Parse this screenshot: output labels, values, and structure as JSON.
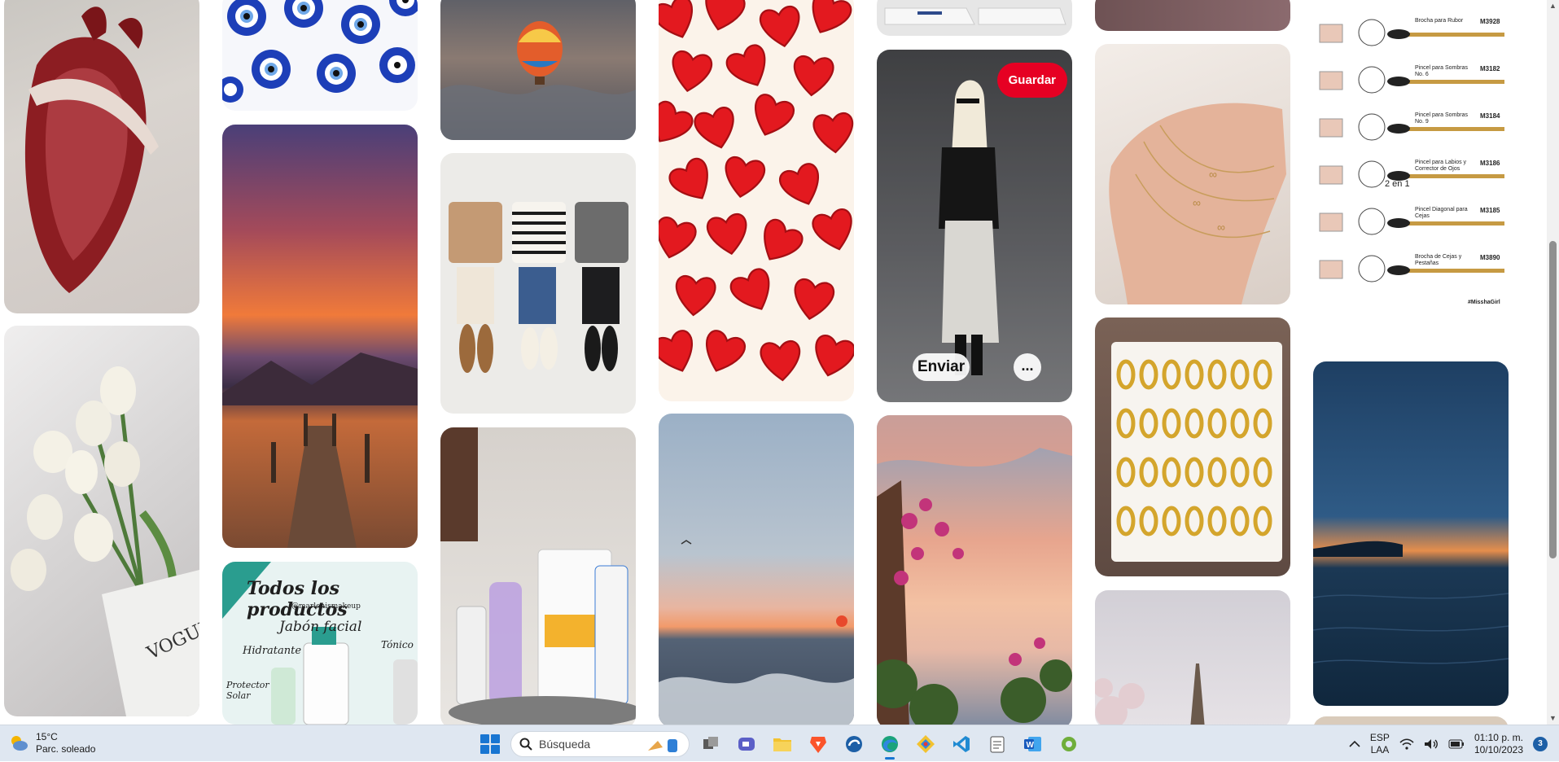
{
  "pins": {
    "guardar_label": "Guardar",
    "enviar_label": "Enviar",
    "more_label": "...",
    "products_title": "Todos los productos",
    "products_handle": "@marlenismakeup",
    "products_line1": "Jabón facial",
    "products_line2": "Hidratante",
    "products_line3": "Tónico",
    "products_line4": "Protector Solar",
    "brush_items": [
      {
        "name": "Brocha para Rubor",
        "code": "M3928"
      },
      {
        "name": "Pincel para Sombras No. 6",
        "code": "M3182"
      },
      {
        "name": "Pincel para Sombras No. 9",
        "code": "M3184"
      },
      {
        "name": "Pincel para Labios y Corrector de Ojos",
        "code": "M3186"
      },
      {
        "name": "Pincel Diagonal para Cejas",
        "code": "M3185"
      },
      {
        "name": "Brocha de Cejas y Pestañas",
        "code": "M3890"
      }
    ],
    "brush_badge": "2 en 1",
    "brush_tag": "#MisshaGirl"
  },
  "taskbar": {
    "temperature": "15°C",
    "weather_desc": "Parc. soleado",
    "search_placeholder": "Búsqueda",
    "lang_top": "ESP",
    "lang_bottom": "LAA",
    "time": "01:10 p. m.",
    "date": "10/10/2023",
    "notification_count": "3"
  },
  "colors": {
    "accent": "#e60023",
    "taskbar_bg": "#dfe7f1"
  }
}
